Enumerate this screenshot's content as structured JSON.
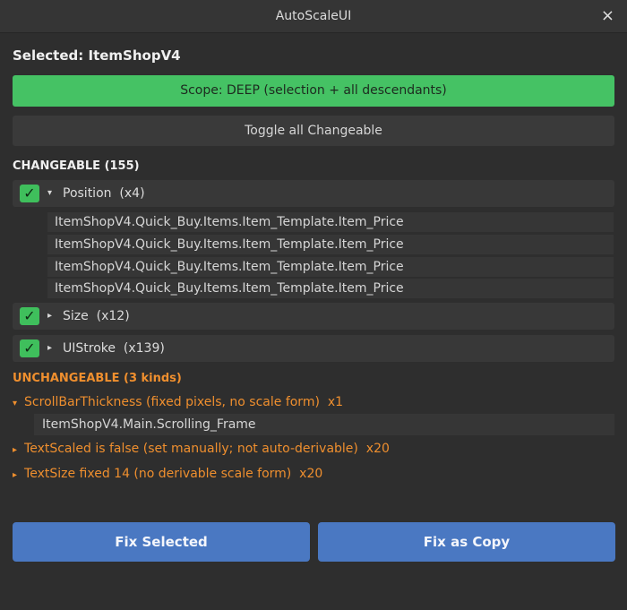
{
  "window": {
    "title": "AutoScaleUI",
    "close_glyph": "×"
  },
  "selected": {
    "label": "Selected: ItemShopV4"
  },
  "scope_button": {
    "label": "Scope: DEEP (selection + all descendants)",
    "color": "#45c264"
  },
  "toggle_button": {
    "label": "Toggle all Changeable"
  },
  "changeable": {
    "title": "CHANGEABLE (155)",
    "groups": [
      {
        "name": "Position",
        "count_label": "(x4)",
        "checked": true,
        "expanded": true,
        "caret": "▾",
        "items": [
          "ItemShopV4.Quick_Buy.Items.Item_Template.Item_Price",
          "ItemShopV4.Quick_Buy.Items.Item_Template.Item_Price",
          "ItemShopV4.Quick_Buy.Items.Item_Template.Item_Price",
          "ItemShopV4.Quick_Buy.Items.Item_Template.Item_Price"
        ]
      },
      {
        "name": "Size",
        "count_label": "(x12)",
        "checked": true,
        "expanded": false,
        "caret": "▸"
      },
      {
        "name": "UIStroke",
        "count_label": "(x139)",
        "checked": true,
        "expanded": false,
        "caret": "▸"
      }
    ]
  },
  "unchangeable": {
    "title": "UNCHANGEABLE (3 kinds)",
    "color": "#ef8f2e",
    "kinds": [
      {
        "caret": "▾",
        "label": "ScrollBarThickness (fixed pixels, no scale form)",
        "count": "x1",
        "expanded": true,
        "items": [
          "ItemShopV4.Main.Scrolling_Frame"
        ]
      },
      {
        "caret": "▸",
        "label": "TextScaled is false (set manually; not auto-derivable)",
        "count": "x20",
        "expanded": false
      },
      {
        "caret": "▸",
        "label": "TextSize fixed 14 (no derivable scale form)",
        "count": "x20",
        "expanded": false
      }
    ]
  },
  "actions": {
    "fix_selected": "Fix Selected",
    "fix_as_copy": "Fix as Copy",
    "color": "#4a78c2"
  },
  "icons": {
    "check": "check-icon",
    "close": "close-icon",
    "caret_down": "caret-down-icon",
    "caret_right": "caret-right-icon"
  }
}
